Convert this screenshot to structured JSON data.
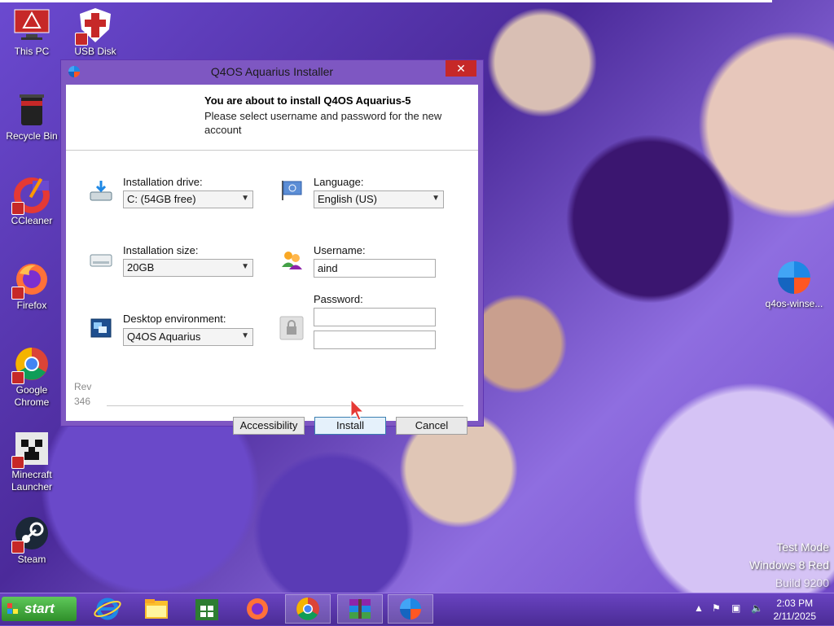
{
  "desktop": {
    "icons_left": [
      {
        "label": "This PC",
        "icon": "this-pc-icon"
      },
      {
        "label": "USB Disk",
        "icon": "usb-disk-icon"
      },
      {
        "label": "Recycle Bin",
        "icon": "recycle-bin-icon"
      },
      {
        "label": "CCleaner",
        "icon": "ccleaner-icon"
      },
      {
        "label": "Firefox",
        "icon": "firefox-icon"
      },
      {
        "label": "Google Chrome",
        "icon": "chrome-icon"
      },
      {
        "label": "Minecraft Launcher",
        "icon": "minecraft-icon"
      },
      {
        "label": "Steam",
        "icon": "steam-icon"
      }
    ],
    "icon_right": {
      "label": "q4os-winse...",
      "icon": "q4os-installer-icon"
    },
    "watermark": [
      "Test Mode",
      "Windows 8 Red",
      "Build 9200"
    ]
  },
  "installer": {
    "window_title": "Q4OS Aquarius Installer",
    "close_glyph": "✕",
    "header_title": "You are about to install Q4OS Aquarius-5",
    "header_subtitle": "Please select username and password for the new account",
    "installation_drive": {
      "label": "Installation drive:",
      "value": "C: (54GB free)"
    },
    "installation_size": {
      "label": "Installation size:",
      "value": "20GB"
    },
    "desktop_environment": {
      "label": "Desktop environment:",
      "value": "Q4OS Aquarius"
    },
    "language": {
      "label": "Language:",
      "value": "English (US)"
    },
    "username": {
      "label": "Username:",
      "value": "aind"
    },
    "password": {
      "label": "Password:",
      "value": "",
      "confirm_value": ""
    },
    "rev": [
      "Rev",
      "346"
    ],
    "buttons": {
      "accessibility": "Accessibility",
      "install": "Install",
      "cancel": "Cancel"
    }
  },
  "taskbar": {
    "start_label": "start",
    "clock_time": "2:03 PM",
    "clock_date": "2/11/2025",
    "pinned": [
      "internet-explorer-icon",
      "file-explorer-icon",
      "store-icon",
      "firefox-icon",
      "chrome-icon",
      "winrar-icon",
      "q4os-installer-icon"
    ],
    "tray": [
      "show-hidden-icon",
      "action-center-flag-icon",
      "network-icon",
      "volume-icon"
    ]
  },
  "colors": {
    "window_frame": "#7e57c2",
    "close_button": "#c62828",
    "taskbar": "#5a38ad"
  }
}
